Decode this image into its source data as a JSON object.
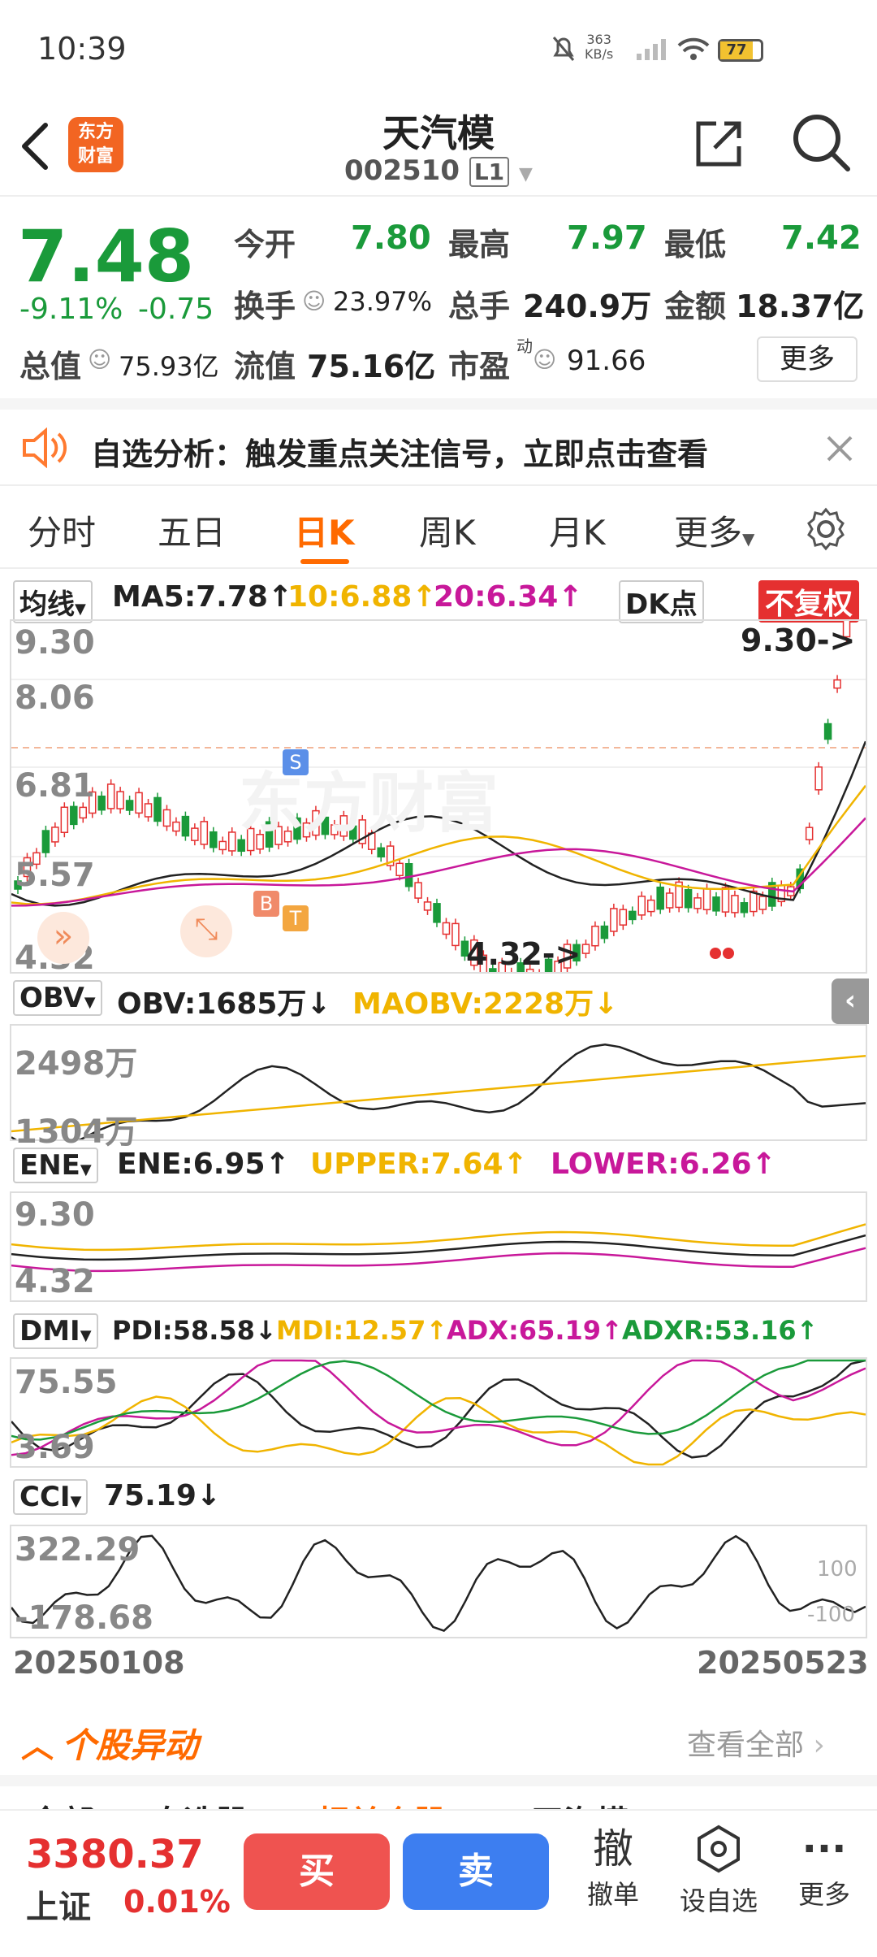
{
  "status_bar": {
    "time": "10:39",
    "net_speed": "363",
    "net_unit": "KB/s",
    "battery": "77"
  },
  "nav": {
    "title": "天汽模",
    "code": "002510",
    "level": "L1",
    "logo_line1": "东方",
    "logo_line2": "财富"
  },
  "quote": {
    "price": "7.48",
    "change_pct": "-9.11%",
    "change": "-0.75",
    "open_label": "今开",
    "open": "7.80",
    "high_label": "最高",
    "high": "7.97",
    "low_label": "最低",
    "low": "7.42",
    "turnover_label": "换手",
    "turnover": "23.97%",
    "volume_label": "总手",
    "volume": "240.9万",
    "amount_label": "金额",
    "amount": "18.37亿",
    "mktcap_label": "总值",
    "mktcap": "75.93亿",
    "float_label": "流值",
    "float": "75.16亿",
    "pe_label": "市盈",
    "pe_sup": "动",
    "pe": "91.66",
    "more": "更多"
  },
  "banner": {
    "text": "自选分析：触发重点关注信号，立即点击查看"
  },
  "tabs": [
    "分时",
    "五日",
    "日K",
    "周K",
    "月K",
    "更多"
  ],
  "active_tab": "日K",
  "kline": {
    "selector": "均线",
    "ma5": "MA5:7.78",
    "ma10": "10:6.88",
    "ma20": "20:6.34",
    "dk": "DK点",
    "fq": "不复权",
    "y_labels": [
      "9.30",
      "8.06",
      "6.81",
      "5.57",
      "4.32"
    ],
    "max_tag": "9.30->",
    "min_tag": "4.32->",
    "watermark": "东方财富",
    "s_tag": "S",
    "b_tag": "B",
    "t_tag": "T"
  },
  "obv": {
    "selector": "OBV",
    "obv": "OBV:1685万",
    "maobv": "MAOBV:2228万",
    "y_labels": [
      "2498万",
      "1304万"
    ]
  },
  "ene": {
    "selector": "ENE",
    "ene": "ENE:6.95",
    "upper": "UPPER:7.64",
    "lower": "LOWER:6.26",
    "y_labels": [
      "9.30",
      "4.32"
    ]
  },
  "dmi": {
    "selector": "DMI",
    "pdi": "PDI:58.58",
    "mdi": "MDI:12.57",
    "adx": "ADX:65.19",
    "adxr": "ADXR:53.16",
    "y_labels": [
      "75.55",
      "3.69"
    ]
  },
  "cci": {
    "selector": "CCI",
    "cci": "75.19",
    "y_labels": [
      "322.29",
      "-178.68"
    ],
    "ref_hi": "100",
    "ref_lo": "-100"
  },
  "dates": {
    "start": "20250108",
    "end": "20250523"
  },
  "news": {
    "title": "个股异动",
    "view_all": "查看全部"
  },
  "subtabs": [
    "全部",
    "自选股",
    "相关个股",
    "天汽模"
  ],
  "bottom": {
    "index_value": "3380.37",
    "index_name": "上证",
    "index_change": "0.01%",
    "buy": "买",
    "sell": "卖",
    "cancel_icon": "撤",
    "cancel_label": "撤单",
    "watch_label": "设自选",
    "more_label": "更多"
  },
  "colors": {
    "up": "#e53030",
    "down": "#1a9a3a",
    "ma10": "#f0b400",
    "ma20": "#c8189a",
    "accent": "#ff6a00",
    "buy": "#ef5350",
    "sell": "#3d7ef0"
  }
}
